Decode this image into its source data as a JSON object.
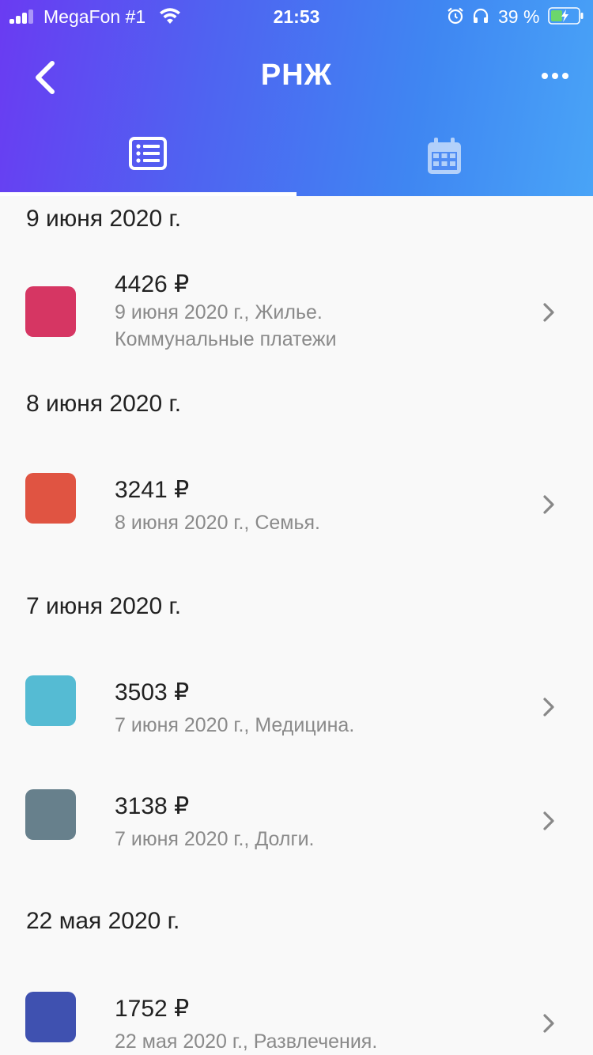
{
  "status_bar": {
    "carrier": "MegaFon #1",
    "time": "21:53",
    "battery_percent": "39 %"
  },
  "header": {
    "title": "РНЖ",
    "back_icon": "chevron-left-icon",
    "more_icon": "more-dots-icon"
  },
  "tabs": [
    {
      "icon": "list-icon",
      "active": true
    },
    {
      "icon": "calendar-icon",
      "active": false
    }
  ],
  "groups": [
    {
      "date": "9 июня 2020 г.",
      "items": [
        {
          "amount": "4426 ₽",
          "desc_line1": "9 июня 2020 г., Жилье.",
          "desc_line2": "Коммунальные платежи",
          "color": "#d63663"
        }
      ]
    },
    {
      "date": "8 июня 2020 г.",
      "items": [
        {
          "amount": "3241 ₽",
          "desc_line1": "8 июня 2020 г., Семья.",
          "desc_line2": "",
          "color": "#e05442"
        }
      ]
    },
    {
      "date": "7 июня 2020 г.",
      "items": [
        {
          "amount": "3503 ₽",
          "desc_line1": "7 июня 2020 г., Медицина.",
          "desc_line2": "",
          "color": "#55bbd3"
        },
        {
          "amount": "3138 ₽",
          "desc_line1": "7 июня 2020 г., Долги.",
          "desc_line2": "",
          "color": "#67808c"
        }
      ]
    },
    {
      "date": "22 мая 2020 г.",
      "items": [
        {
          "amount": "1752 ₽",
          "desc_line1": "22 мая 2020 г., Развлечения.",
          "desc_line2": "",
          "color": "#3f51b0"
        }
      ]
    }
  ]
}
